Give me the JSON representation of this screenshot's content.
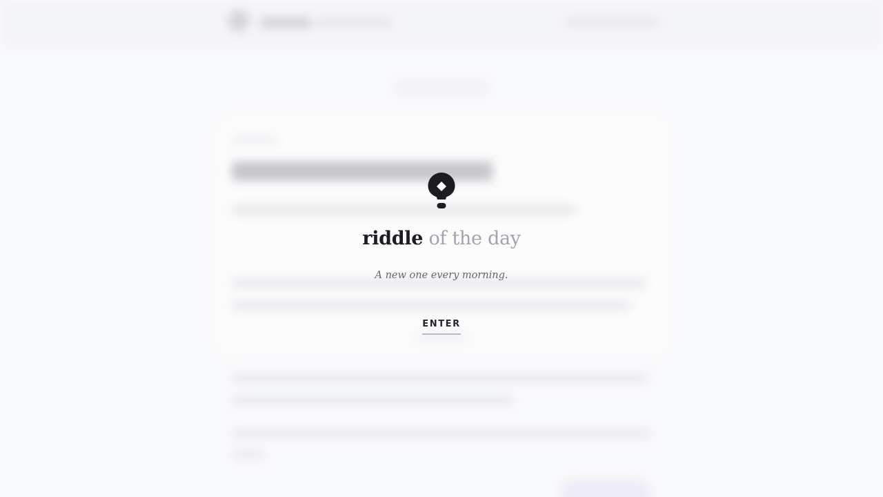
{
  "splash": {
    "title_strong": "riddle",
    "title_light": "of the day",
    "tagline": "A new one every morning.",
    "enter_label": "ENTER",
    "icon": "lightbulb-icon"
  },
  "colors": {
    "background": "#f9fafc",
    "title_dark": "#1c1c22",
    "title_light": "#a2a3ab",
    "tagline": "#66676f",
    "underline": "#b9bac1"
  }
}
